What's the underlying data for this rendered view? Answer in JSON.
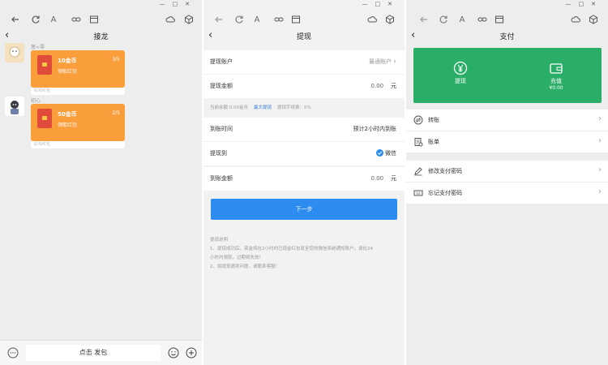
{
  "chat": {
    "title": "接龙",
    "messages": [
      {
        "nickname": "葱<零",
        "amount": "10金币",
        "subtitle": "领取红包",
        "count": "3/5",
        "footer": "彩鸡红包"
      },
      {
        "nickname": "初心",
        "amount": "50金币",
        "subtitle": "领取红包",
        "count": "2/5",
        "footer": "彩鸡红包"
      }
    ],
    "input_button": "点击 发包"
  },
  "withdraw": {
    "title": "提现",
    "account_label": "提现账户",
    "account_value": "最通账户",
    "amount_label": "提现金额",
    "amount_value": "0.00",
    "amount_unit": "元",
    "balance_hint": "当前余额 0.00金币",
    "max_link": "最大提现",
    "fee_hint": "提现手续费：5%",
    "arrival_time_label": "到账时间",
    "arrival_time_value": "预计2小时内到账",
    "withdraw_to_label": "提现到",
    "withdraw_to_value": "微信",
    "arrival_amount_label": "到账金额",
    "arrival_amount_value": "0.00",
    "arrival_amount_unit": "元",
    "next_button": "下一步",
    "notes_title": "提现说明",
    "notes_line1": "1、提现成功后，资金将在2小时内已现金红包发至您的微信系统通知账户，请在24",
    "notes_line2": "小时内领取，过期将失效！",
    "notes_line3": "2、如提现遇到问题，请联系客服！"
  },
  "pay": {
    "title": "支付",
    "withdraw_label": "提现",
    "recharge_label": "充值",
    "recharge_amount": "¥0.00",
    "items": [
      {
        "label": "转账",
        "icon": "transfer-icon"
      },
      {
        "label": "账单",
        "icon": "bill-icon"
      },
      {
        "label": "修改支付密码",
        "icon": "edit-icon"
      },
      {
        "label": "忘记支付密码",
        "icon": "keyboard-icon"
      }
    ]
  },
  "colors": {
    "accent_blue": "#2d8cf0",
    "pay_green": "#2aae67",
    "redpacket_orange": "#fa9d3b"
  }
}
